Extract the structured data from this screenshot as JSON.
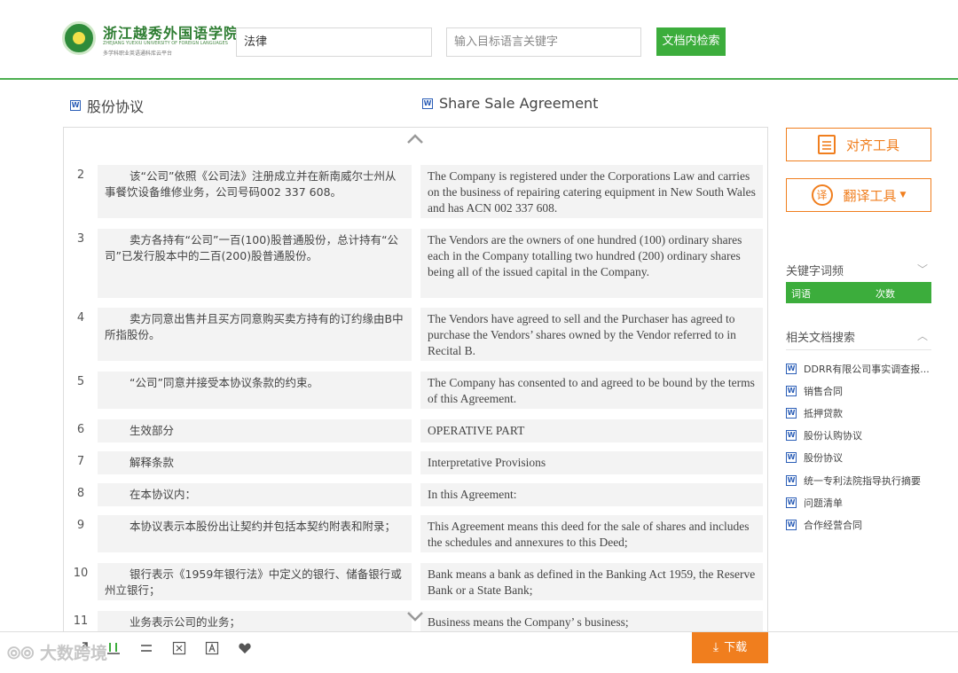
{
  "header": {
    "logo_cn": "浙江越秀外国语学院",
    "logo_en": "ZHEJIANG YUEXIU UNIVERSITY OF FOREIGN LANGUAGES",
    "logo_sub": "多学科职业英语通科库云平台",
    "search_value": "法律",
    "target_placeholder": "输入目标语言关键字",
    "search_button": "文档内检索"
  },
  "doc": {
    "title_cn": "股份协议",
    "title_en": "Share Sale Agreement"
  },
  "rows": [
    {
      "num": "2",
      "cn": "该“公司”依照《公司法》注册成立并在新南威尔士州从事餐饮设备维修业务，公司号码002 337 608。",
      "en": "The Company is registered under the Corporations Law and carries on the business of repairing catering equipment in New South Wales and has ACN 002 337 608."
    },
    {
      "num": "3",
      "cn": "卖方各持有“公司”一百(100)股普通股份，总计持有“公司”已发行股本中的二百(200)股普通股份。",
      "en": "The Vendors are the owners of one hundred (100) ordinary shares each in the Company totalling two hundred (200) ordinary shares being all of the issued capital in the Company."
    },
    {
      "num": "4",
      "cn": "卖方同意出售并且买方同意购买卖方持有的订约缘由B中所指股份。",
      "en": "The Vendors have agreed to sell and the Purchaser has agreed to purchase the Vendors’  shares owned by the Vendor referred to in Recital B."
    },
    {
      "num": "5",
      "cn": "“公司”同意并接受本协议条款的约束。",
      "en": "The Company has consented to and agreed to be bound by the terms of this Agreement."
    },
    {
      "num": "6",
      "cn": "生效部分",
      "en": "OPERATIVE PART"
    },
    {
      "num": "7",
      "cn": "解释条款",
      "en": "Interpretative Provisions"
    },
    {
      "num": "8",
      "cn": "在本协议内：",
      "en": "In this Agreement:"
    },
    {
      "num": "9",
      "cn": "本协议表示本股份出让契约并包括本契约附表和附录；",
      "en": "This Agreement means this deed for the sale of shares and includes the schedules and annexures to this Deed;"
    },
    {
      "num": "10",
      "cn": "银行表示《1959年银行法》中定义的银行、储备银行或州立银行；",
      "en": "Bank means a bank as defined in the Banking Act 1959, the Reserve Bank or a State Bank;"
    },
    {
      "num": "11",
      "cn": "业务表示公司的业务；",
      "en": "Business means the Company’ s business;"
    }
  ],
  "toolbar": {
    "download": "下载",
    "watermark": "大数跨境"
  },
  "sidebar": {
    "align_tool": "对齐工具",
    "translate_tool": "翻译工具",
    "translate_icon_char": "译",
    "keyword_head": "关键字词频",
    "kw_col1": "词语",
    "kw_col2": "次数",
    "related_head": "相关文档搜索",
    "related": [
      "DDRR有限公司事实调查报...",
      "销售合同",
      "抵押贷款",
      "股份认购协议",
      "股份协议",
      "统一专利法院指导执行摘要",
      "问题清单",
      "合作经营合同"
    ]
  },
  "colors": {
    "accent_green": "#3cad3c",
    "accent_orange": "#f07e1e"
  }
}
